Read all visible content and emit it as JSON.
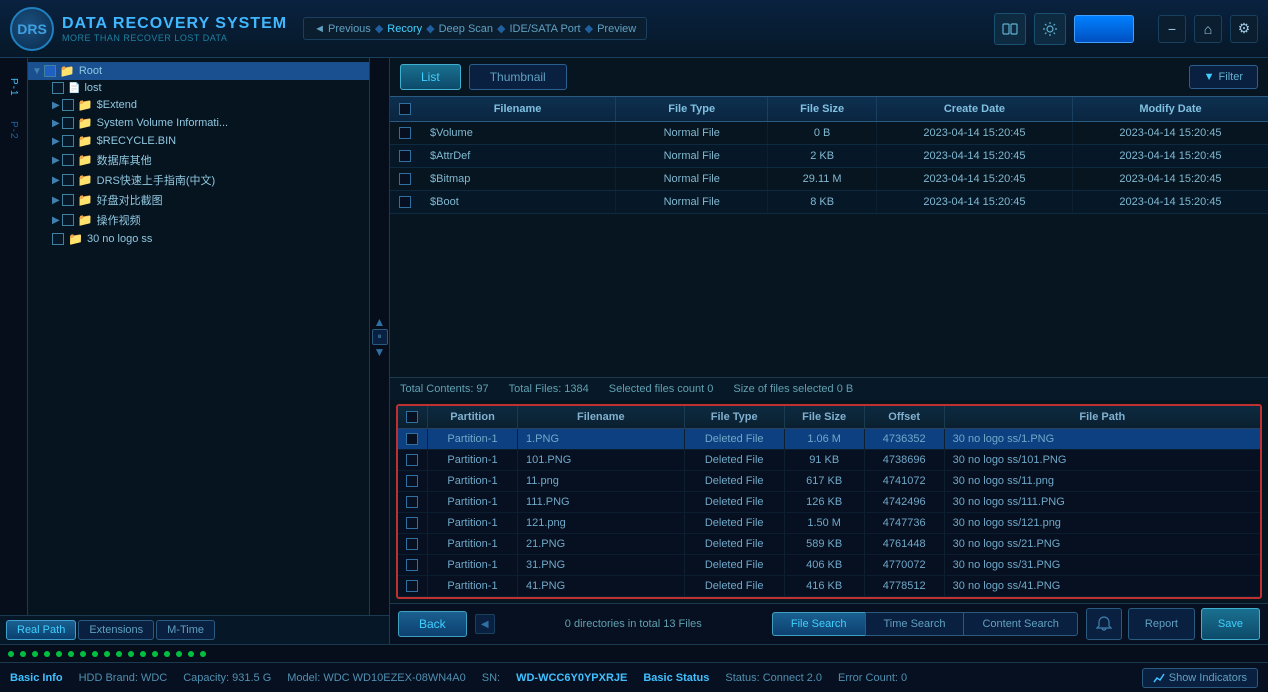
{
  "app": {
    "title": "DATA RECOVERY SYSTEM",
    "subtitle": "MORE THAN RECOVER LOST DATA",
    "logo": "DRS"
  },
  "nav": {
    "prev_label": "◄ Previous",
    "items": [
      "Recory",
      "Deep Scan",
      "IDE/SATA Port",
      "Preview"
    ]
  },
  "view_tabs": {
    "list": "List",
    "thumbnail": "Thumbnail",
    "filter": "Filter"
  },
  "file_table": {
    "headers": {
      "filename": "Filename",
      "filetype": "File Type",
      "filesize": "File Size",
      "createdate": "Create Date",
      "modifydate": "Modify Date"
    },
    "rows": [
      {
        "name": "$Volume",
        "type": "Normal File",
        "size": "0 B",
        "create": "2023-04-14 15:20:45",
        "modify": "2023-04-14 15:20:45"
      },
      {
        "name": "$AttrDef",
        "type": "Normal File",
        "size": "2 KB",
        "create": "2023-04-14 15:20:45",
        "modify": "2023-04-14 15:20:45"
      },
      {
        "name": "$Bitmap",
        "type": "Normal File",
        "size": "29.11 M",
        "create": "2023-04-14 15:20:45",
        "modify": "2023-04-14 15:20:45"
      },
      {
        "name": "$Boot",
        "type": "Normal File",
        "size": "8 KB",
        "create": "2023-04-14 15:20:45",
        "modify": "2023-04-14 15:20:45"
      }
    ],
    "footer": {
      "total_contents": "Total Contents: 97",
      "total_files": "Total Files: 1384",
      "selected_count": "Selected files count 0",
      "selected_size": "Size of files selected 0 B"
    }
  },
  "tree": {
    "root": "Root",
    "items": [
      {
        "label": "lost",
        "indent": 1,
        "type": "file"
      },
      {
        "label": "$Extend",
        "indent": 1,
        "type": "folder"
      },
      {
        "label": "System Volume Informati...",
        "indent": 1,
        "type": "folder"
      },
      {
        "label": "$RECYCLE.BIN",
        "indent": 1,
        "type": "folder"
      },
      {
        "label": "数据库其他",
        "indent": 1,
        "type": "folder_yellow"
      },
      {
        "label": "DRS快速上手指南(中文)",
        "indent": 1,
        "type": "folder_yellow"
      },
      {
        "label": "好盘对比截图",
        "indent": 1,
        "type": "folder_yellow"
      },
      {
        "label": "操作视频",
        "indent": 1,
        "type": "folder_yellow"
      },
      {
        "label": "30 no logo ss",
        "indent": 1,
        "type": "folder_yellow"
      }
    ]
  },
  "path_tabs": {
    "real_path": "Real Path",
    "extensions": "Extensions",
    "m_time": "M-Time"
  },
  "search": {
    "tabs": {
      "file_search": "File Search",
      "time_search": "Time Search",
      "content_search": "Content Search"
    },
    "headers": {
      "partition": "Partition",
      "filename": "Filename",
      "filetype": "File Type",
      "filesize": "File Size",
      "offset": "Offset",
      "filepath": "File Path"
    },
    "rows": [
      {
        "partition": "Partition-1",
        "filename": "1.PNG",
        "filetype": "Deleted File",
        "filesize": "1.06 M",
        "offset": "4736352",
        "filepath": "30 no logo ss/1.PNG"
      },
      {
        "partition": "Partition-1",
        "filename": "101.PNG",
        "filetype": "Deleted File",
        "filesize": "91 KB",
        "offset": "4738696",
        "filepath": "30 no logo ss/101.PNG"
      },
      {
        "partition": "Partition-1",
        "filename": "11.png",
        "filetype": "Deleted File",
        "filesize": "617 KB",
        "offset": "4741072",
        "filepath": "30 no logo ss/11.png"
      },
      {
        "partition": "Partition-1",
        "filename": "111.PNG",
        "filetype": "Deleted File",
        "filesize": "126 KB",
        "offset": "4742496",
        "filepath": "30 no logo ss/111.PNG"
      },
      {
        "partition": "Partition-1",
        "filename": "121.png",
        "filetype": "Deleted File",
        "filesize": "1.50 M",
        "offset": "4747736",
        "filepath": "30 no logo ss/121.png"
      },
      {
        "partition": "Partition-1",
        "filename": "21.PNG",
        "filetype": "Deleted File",
        "filesize": "589 KB",
        "offset": "4761448",
        "filepath": "30 no logo ss/21.PNG"
      },
      {
        "partition": "Partition-1",
        "filename": "31.PNG",
        "filetype": "Deleted File",
        "filesize": "406 KB",
        "offset": "4770072",
        "filepath": "30 no logo ss/31.PNG"
      },
      {
        "partition": "Partition-1",
        "filename": "41.PNG",
        "filetype": "Deleted File",
        "filesize": "416 KB",
        "offset": "4778512",
        "filepath": "30 no logo ss/41.PNG"
      }
    ],
    "dir_info": "0 directories in total 13 Files"
  },
  "actions": {
    "back": "Back",
    "report": "Report",
    "save": "Save",
    "show_indicators": "Show Indicators"
  },
  "status": {
    "basic_info": "Basic Info",
    "hdd_brand": "HDD Brand: WDC",
    "capacity": "Capacity: 931.5 G",
    "model": "Model: WDC WD10EZEX-08WN4A0",
    "sn": "SN:",
    "sn_value": "WD-WCC6Y0YPXRJE",
    "basic_status": "Basic Status",
    "status_text": "Status: Connect 2.0",
    "error_count": "Error Count: 0"
  },
  "partitions": {
    "p1": "P-1",
    "p2": "P-2"
  }
}
